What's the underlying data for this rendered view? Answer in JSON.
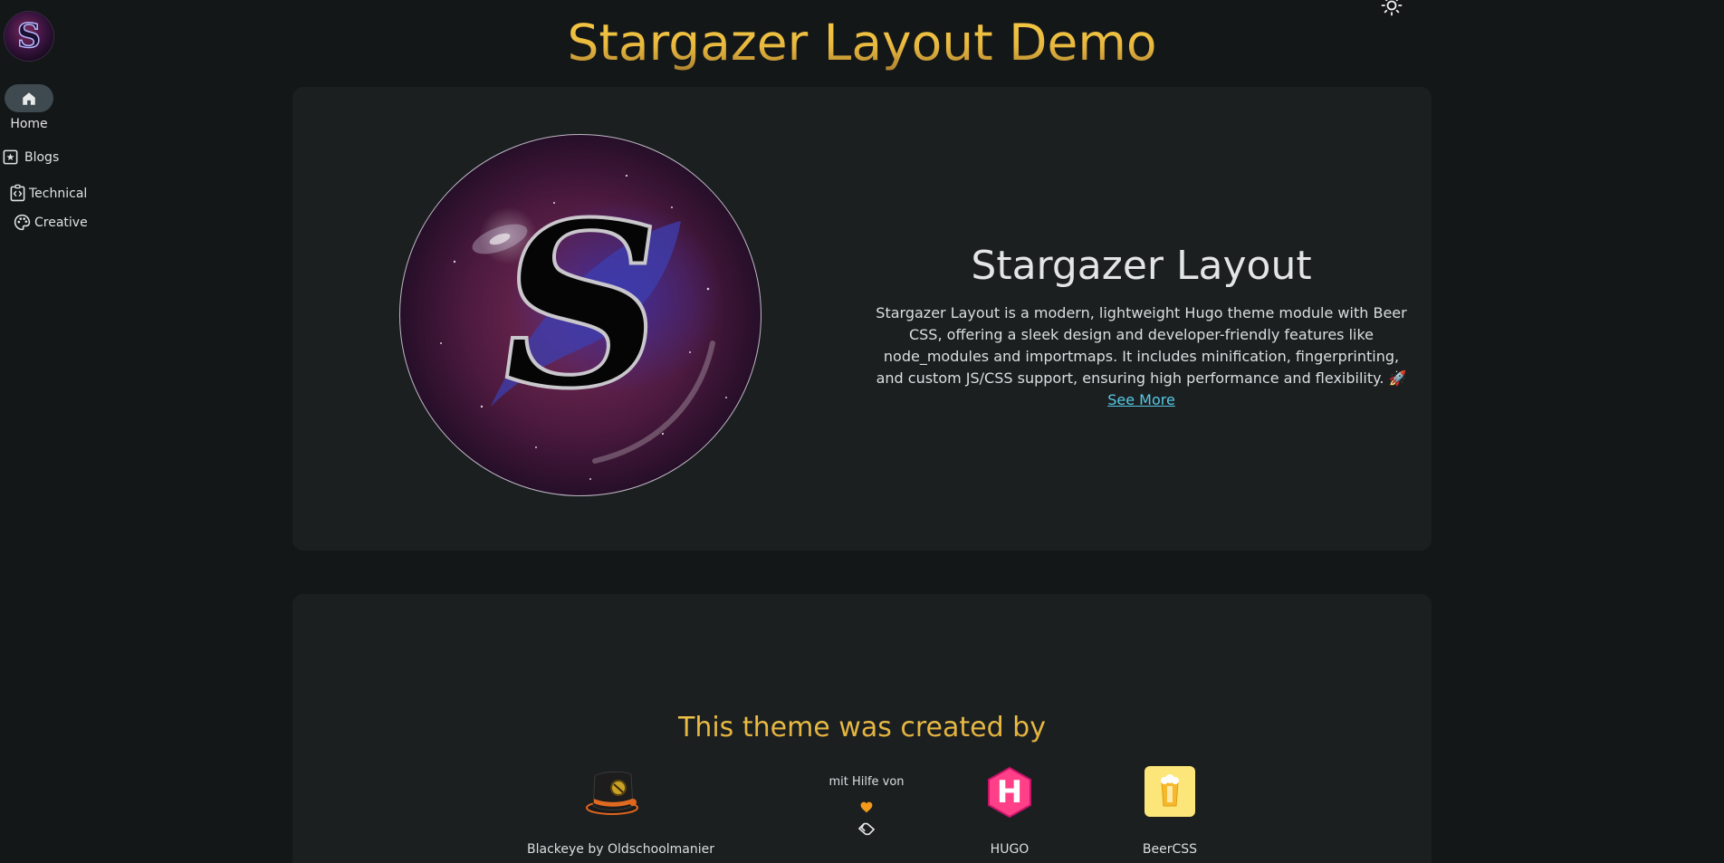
{
  "sidebar": {
    "logo_letter": "S",
    "items": [
      {
        "label": "Home",
        "icon": "home-icon",
        "active": true
      },
      {
        "label": "Blogs",
        "icon": "star-box-icon"
      },
      {
        "label": "Technical",
        "icon": "code-icon"
      },
      {
        "label": "Creative",
        "icon": "palette-icon"
      }
    ]
  },
  "header": {
    "title": "Stargazer Layout Demo",
    "theme_toggle_icon": "sun-icon"
  },
  "hero": {
    "heading": "Stargazer Layout",
    "description": "Stargazer Layout is a modern, lightweight Hugo theme module with Beer CSS, offering a sleek design and developer-friendly features like node_modules and importmaps. It includes minification, fingerprinting, and custom JS/CSS support, ensuring high performance and flexibility. 🚀",
    "link_label": "See More",
    "image_letter": "S"
  },
  "credits": {
    "title": "This theme was created by",
    "helper_text": "mit Hilfe von",
    "items": [
      {
        "label": "Blackeye by Oldschoolmanier",
        "icon": "top-hat-icon"
      },
      {
        "label": "HUGO",
        "icon": "hugo-logo-icon",
        "logo_letter": "H"
      },
      {
        "label": "BeerCSS",
        "icon": "beer-icon"
      }
    ]
  },
  "colors": {
    "background": "#141718",
    "card": "#1b1f20",
    "accent_gold": "#f0c242",
    "link": "#58c8e6",
    "heart": "#f39a1c",
    "hugo_pink": "#ff4088",
    "beer_yellow": "#fce67a"
  }
}
